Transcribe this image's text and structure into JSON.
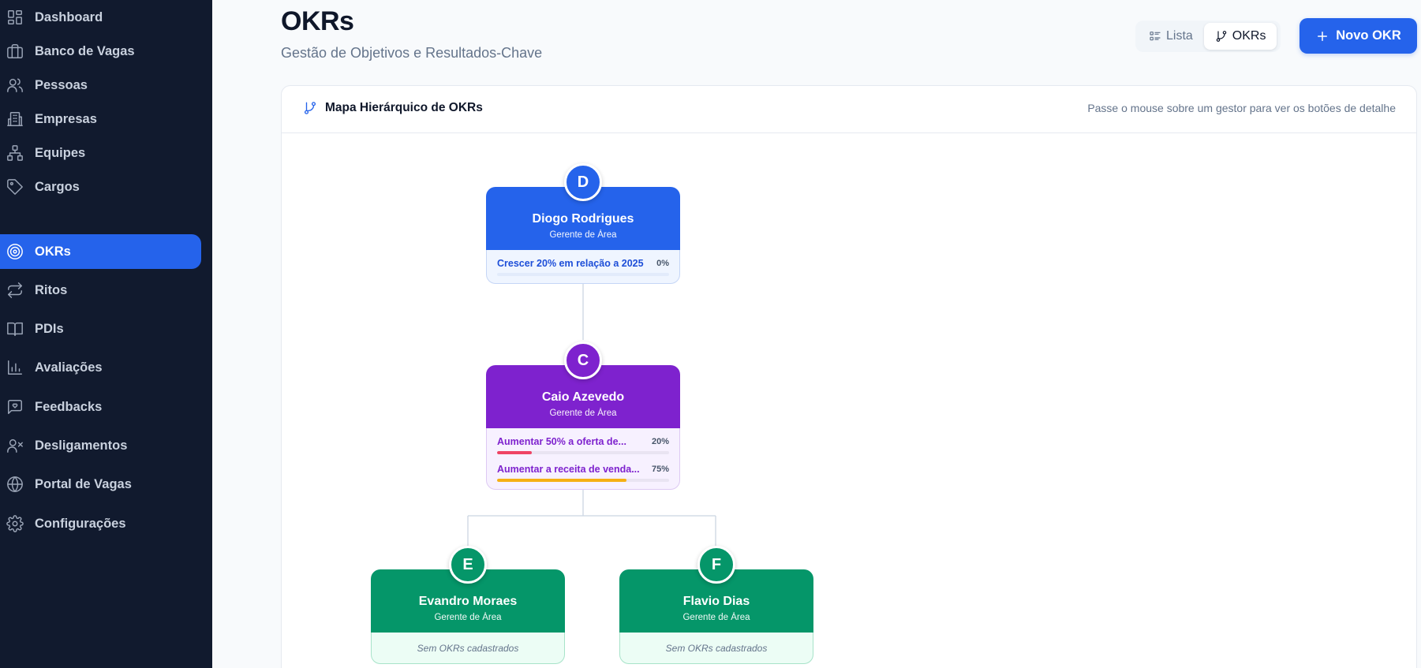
{
  "sidebar": {
    "items": [
      {
        "label": "Dashboard",
        "icon": "dashboard-icon",
        "active": false
      },
      {
        "label": "Banco de Vagas",
        "icon": "briefcase-icon",
        "active": false
      },
      {
        "label": "Pessoas",
        "icon": "users-icon",
        "active": false
      },
      {
        "label": "Empresas",
        "icon": "building-icon",
        "active": false
      },
      {
        "label": "Equipes",
        "icon": "network-icon",
        "active": false
      },
      {
        "label": "Cargos",
        "icon": "tag-icon",
        "active": false
      },
      {
        "label": "OKRs",
        "icon": "target-icon",
        "active": true
      },
      {
        "label": "Ritos",
        "icon": "repeat-icon",
        "active": false
      },
      {
        "label": "PDIs",
        "icon": "book-icon",
        "active": false
      },
      {
        "label": "Avaliações",
        "icon": "bar-chart-icon",
        "active": false
      },
      {
        "label": "Feedbacks",
        "icon": "message-heart-icon",
        "active": false
      },
      {
        "label": "Desligamentos",
        "icon": "user-x-icon",
        "active": false
      },
      {
        "label": "Portal de Vagas",
        "icon": "globe-icon",
        "active": false
      },
      {
        "label": "Configurações",
        "icon": "gear-icon",
        "active": false
      }
    ]
  },
  "header": {
    "title": "OKRs",
    "subtitle": "Gestão de Objetivos e Resultados-Chave",
    "view_toggle": {
      "list_label": "Lista",
      "okrs_label": "OKRs",
      "active": "OKRs"
    },
    "new_button_label": "Novo OKR"
  },
  "map": {
    "title": "Mapa Hierárquico de OKRs",
    "hint": "Passe o mouse sobre um gestor para ver os botões de detalhe",
    "nodes": [
      {
        "initial": "D",
        "name": "Diogo Rodrigues",
        "role": "Gerente de Área",
        "color": "#2563eb",
        "objectives": [
          {
            "label": "Crescer 20% em relação a 2025",
            "percent_label": "0%",
            "progress": 0,
            "bar_color": "#2563eb"
          }
        ]
      },
      {
        "initial": "C",
        "name": "Caio Azevedo",
        "role": "Gerente de Área",
        "color": "#7e22ce",
        "objectives": [
          {
            "label": "Aumentar 50% a oferta de...",
            "percent_label": "20%",
            "progress": 20,
            "bar_color": "#ef4464"
          },
          {
            "label": "Aumentar a receita de venda...",
            "percent_label": "75%",
            "progress": 75,
            "bar_color": "#f5b014"
          }
        ]
      },
      {
        "initial": "E",
        "name": "Evandro Moraes",
        "role": "Gerente de Área",
        "color": "#059669",
        "empty_text": "Sem OKRs cadastrados"
      },
      {
        "initial": "F",
        "name": "Flavio Dias",
        "role": "Gerente de Área",
        "color": "#059669",
        "empty_text": "Sem OKRs cadastrados"
      }
    ]
  },
  "colors": {
    "sidebar_bg": "#111a2e",
    "accent": "#2563eb"
  }
}
